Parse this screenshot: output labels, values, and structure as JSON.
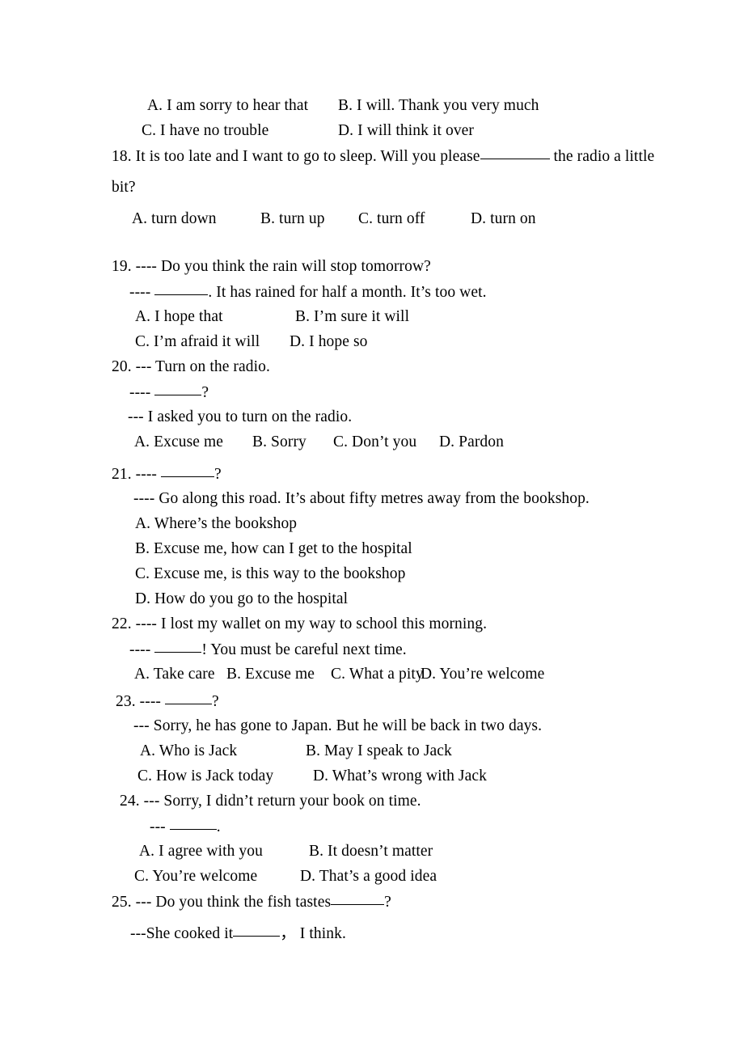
{
  "document": {
    "type": "english-multiple-choice-worksheet",
    "background_color": "#ffffff",
    "text_color": "#000000"
  },
  "q17_options": {
    "a": "A. I am sorry to hear that",
    "b": "B. I will. Thank you very much",
    "c": "C. I have no trouble",
    "d": "D. I will think it over"
  },
  "q18": {
    "stem_part1": "18. It is too late and I want to go to sleep. Will you please",
    "stem_part2": "the radio a little",
    "stem_line2": "bit?",
    "a": "A. turn down",
    "b": "B. turn up",
    "c": "C. turn off",
    "d": "D. turn on"
  },
  "q19": {
    "line1": "19. ---- Do you think the rain will stop tomorrow?",
    "line2_prefix": "----",
    "line2_suffix": ". It has rained for half a month. It’s too wet.",
    "a": "A. I hope that",
    "b": "B. I’m sure it will",
    "c": "C. I’m afraid it will",
    "d": "D. I hope so"
  },
  "q20": {
    "line1": "20. --- Turn on the radio.",
    "line2_prefix": "----",
    "line2_suffix": "?",
    "line3": "--- I asked you to turn on the radio.",
    "a": "A. Excuse me",
    "b": "B. Sorry",
    "c": "C. Don’t you",
    "d": "D. Pardon"
  },
  "q21": {
    "line1_prefix": "21. ----",
    "line1_suffix": "?",
    "line2": "---- Go along this road. It’s about fifty metres away from the bookshop.",
    "a": "A. Where’s the bookshop",
    "b": "B. Excuse me, how can I get to the hospital",
    "c": "C. Excuse me, is this way to the bookshop",
    "d": "D. How do you go to the hospital"
  },
  "q22": {
    "line1": "22. ---- I lost my wallet on my way to school this morning.",
    "line2_prefix": "----",
    "line2_suffix": "! You must be careful next time.",
    "a": "A. Take care",
    "b": "B. Excuse me",
    "c": "C. What a pity",
    "d": "D. You’re welcome"
  },
  "q23": {
    "line1_prefix": "23. ----",
    "line1_suffix": "?",
    "line2": "--- Sorry, he has gone to Japan. But he will be back in two days.",
    "a": "A. Who is Jack",
    "b": "B. May I speak to Jack",
    "c": "C. How is Jack today",
    "d": "D. What’s wrong with Jack"
  },
  "q24": {
    "line1": "24. --- Sorry, I didn’t return your book on time.",
    "line2_prefix": "---",
    "line2_suffix": ".",
    "a": "A. I agree with you",
    "b": "B. It doesn’t matter",
    "c": "C. You’re welcome",
    "d": "D. That’s a good idea"
  },
  "q25": {
    "line1_prefix": "25. --- Do you think the fish tastes",
    "line1_suffix": "?",
    "line2_prefix": "---She cooked it",
    "line2_suffix": "， I think."
  }
}
